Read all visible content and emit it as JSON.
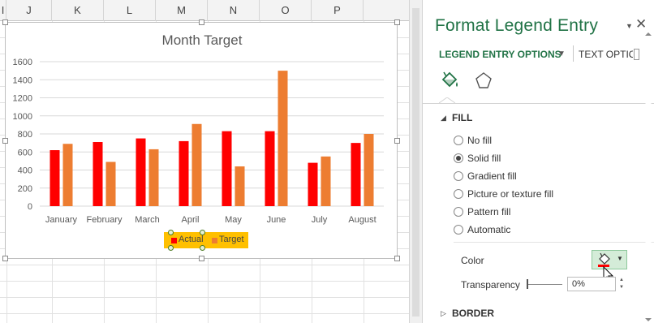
{
  "sheet": {
    "columns": [
      {
        "label": "I"
      },
      {
        "label": "J"
      },
      {
        "label": "K"
      },
      {
        "label": "L"
      },
      {
        "label": "M"
      },
      {
        "label": "N"
      },
      {
        "label": "O"
      },
      {
        "label": "P"
      }
    ]
  },
  "chart_data": {
    "type": "bar",
    "title": "Month Target",
    "categories": [
      "January",
      "February",
      "March",
      "April",
      "May",
      "June",
      "July",
      "August"
    ],
    "series": [
      {
        "name": "Actual",
        "color": "#ff0000",
        "values": [
          620,
          710,
          750,
          720,
          830,
          830,
          480,
          700
        ]
      },
      {
        "name": "Target",
        "color": "#ed7d31",
        "values": [
          690,
          490,
          630,
          910,
          440,
          1500,
          550,
          800
        ]
      }
    ],
    "yticks": [
      "0",
      "200",
      "400",
      "600",
      "800",
      "1000",
      "1200",
      "1400",
      "1600"
    ],
    "ylim": [
      0,
      1600
    ],
    "grid": true,
    "legend_position": "bottom",
    "legend_selected_entry": "Actual",
    "legend_background": "#ffc000"
  },
  "pane": {
    "title": "Format Legend Entry",
    "close_glyph": "✕",
    "menu_arrow": "▼",
    "tabs": {
      "legend_entry_options": "LEGEND ENTRY OPTIONS",
      "caret": "▼",
      "text_options": "TEXT OPTIO"
    },
    "icons": {
      "fill": "paint-bucket-icon",
      "shape": "pentagon-icon"
    },
    "fill_section": {
      "caret": "◢",
      "title": "FILL",
      "options": [
        {
          "label": "No fill",
          "checked": false
        },
        {
          "label": "Solid fill",
          "checked": true
        },
        {
          "label": "Gradient fill",
          "checked": false
        },
        {
          "label": "Picture or texture fill",
          "checked": false
        },
        {
          "label": "Pattern fill",
          "checked": false
        },
        {
          "label": "Automatic",
          "checked": false
        }
      ],
      "color_label": "Color",
      "color_value": "#ff0000",
      "transparency_label": "Transparency",
      "transparency_value": "0%",
      "transparency_level": 0
    },
    "border_section": {
      "caret": "▷",
      "title": "BORDER"
    }
  },
  "colors": {
    "accent": "#217346",
    "selected_button_bg": "#d4ecd8"
  }
}
